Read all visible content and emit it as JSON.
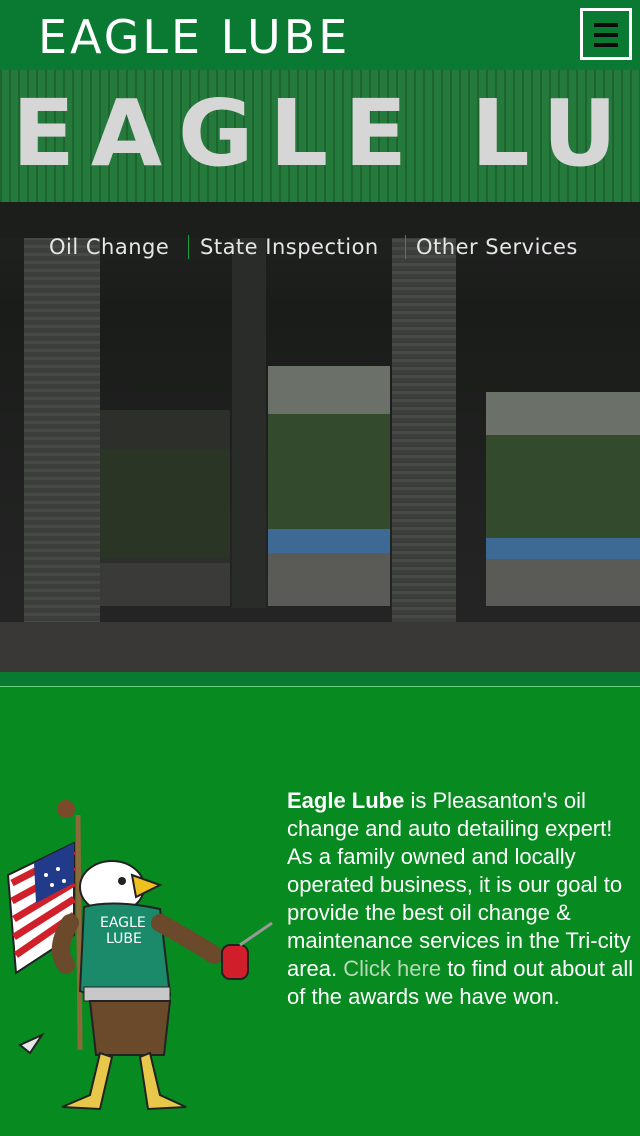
{
  "header": {
    "title": "EAGLE LUBE",
    "menu_icon": "hamburger-menu-icon"
  },
  "hero": {
    "sign_text": "EAGLE LUBE"
  },
  "nav": {
    "items": [
      {
        "label": "Oil Change"
      },
      {
        "label": "State Inspection"
      },
      {
        "label": "Other Services"
      }
    ]
  },
  "about": {
    "brand": "Eagle Lube",
    "text_before_link": " is Pleasanton's oil change and auto detailing expert! As a family owned and locally operated business, it is our goal to provide the best oil change & maintenance services in the Tri-city area. ",
    "link_text": "Click here",
    "text_after_link": " to find out about all of the awards we have won."
  },
  "mascot": {
    "shirt_text_line1": "EAGLE",
    "shirt_text_line2": "LUBE"
  },
  "colors": {
    "header_green": "#0a7a32",
    "content_green": "#078a1f",
    "nav_separator": "#17a043",
    "link": "#b6d9b6"
  }
}
